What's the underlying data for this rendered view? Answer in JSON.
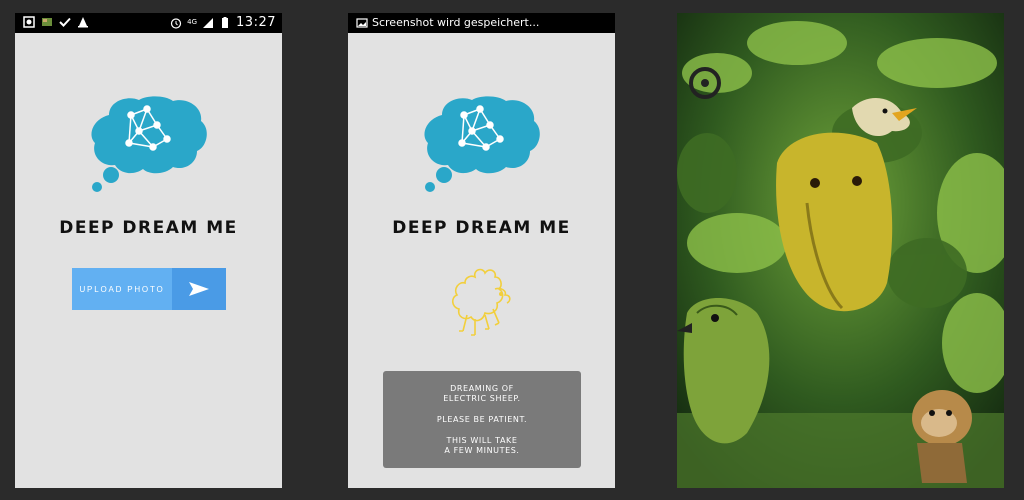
{
  "screen1": {
    "status": {
      "time": "13:27",
      "network": "4G"
    },
    "title": "DEEP DREAM ME",
    "upload_label": "UPLOAD PHOTO"
  },
  "screen2": {
    "status": {
      "notification": "Screenshot wird gespeichert..."
    },
    "title": "DEEP DREAM ME",
    "toast": {
      "line1": "DREAMING OF",
      "line2": "ELECTRIC SHEEP.",
      "line3": "PLEASE BE PATIENT.",
      "line4": "THIS WILL TAKE",
      "line5": "A FEW MINUTES."
    }
  },
  "colors": {
    "brain": "#2aa7c9",
    "button": "#62b0f2",
    "button_arrow": "#4a9be6",
    "sheep": "#f2cf3c",
    "toast": "#7a7a7a"
  },
  "icons": [
    "brain-network-logo",
    "send-arrow-icon",
    "sheep-outline-icon",
    "alarm-icon",
    "battery-icon",
    "signal-icon"
  ]
}
